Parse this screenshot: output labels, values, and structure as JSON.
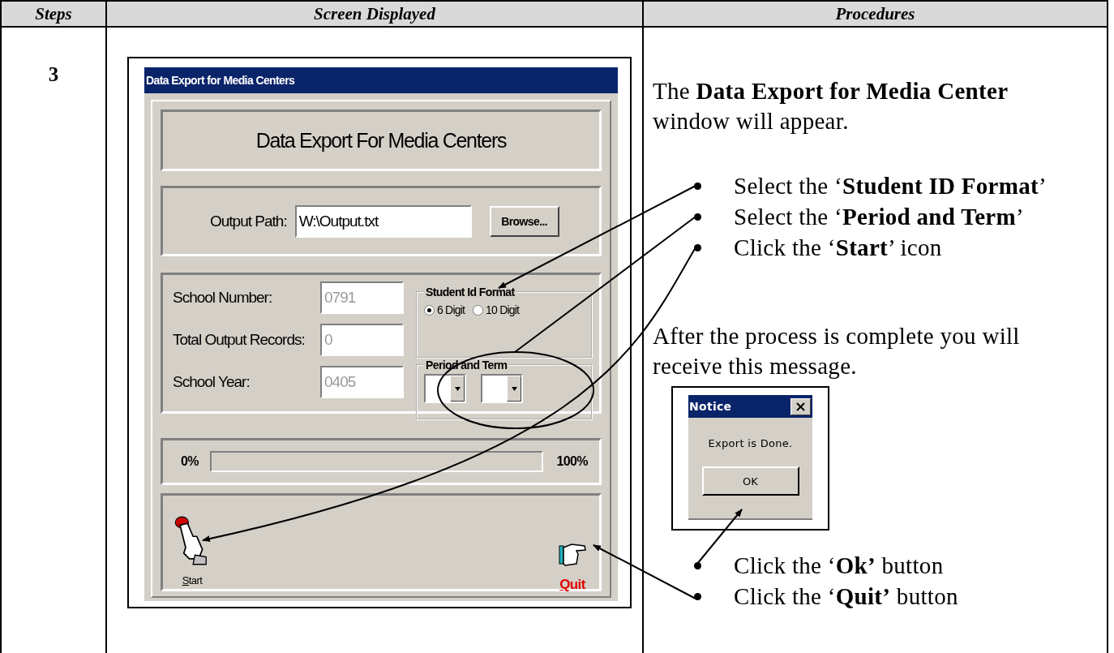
{
  "table": {
    "columns": [
      "Steps",
      "Screen Displayed",
      "Procedures"
    ],
    "rows": [
      {
        "step": "3",
        "screen": {
          "window_title": "Data Export for Media Centers",
          "heading": "Data Export For Media Centers",
          "output_path": {
            "label": "Output Path:",
            "value": "W:\\Output.txt"
          },
          "browse_button": "Browse...",
          "fields": [
            {
              "label": "School Number:",
              "value": "0791",
              "disabled": true
            },
            {
              "label": "Total Output Records:",
              "value": "0",
              "disabled": true
            },
            {
              "label": "School Year:",
              "value": "0405",
              "disabled": true
            }
          ],
          "student_id_format": {
            "title": "Student Id Format",
            "options": [
              {
                "label": "6 Digit",
                "selected": true
              },
              {
                "label": "10 Digit",
                "selected": false
              }
            ]
          },
          "period_and_term": {
            "title": "Period and Term"
          },
          "progress": {
            "start_label": "0%",
            "end_label": "100%",
            "level": 0
          },
          "buttons": [
            {
              "kind": "start",
              "label": "Start"
            },
            {
              "kind": "quit",
              "label": "Quit"
            }
          ]
        },
        "procedures": {
          "intro": "The **Data Export for Media Center** window will appear.",
          "steps_before": [
            "Select the ‘**Student ID Format**’",
            "Select the ‘**Period and Term**’",
            "Click the ‘**Start**’ icon"
          ],
          "message_text": "After the process is complete you will receive this message.",
          "notice": {
            "title": "Notice",
            "message": "Export is Done.",
            "button": "OK"
          },
          "steps_after": [
            "Click the ‘**Ok’** button",
            "Click the ‘**Quit’** button"
          ]
        }
      }
    ]
  }
}
